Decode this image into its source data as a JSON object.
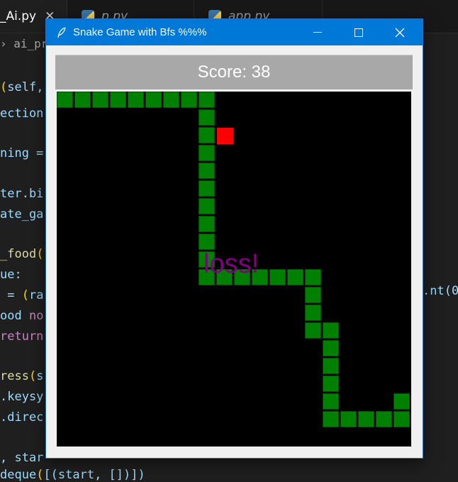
{
  "editor": {
    "tabs": [
      {
        "label": "_Ai.py",
        "close": "✕"
      },
      {
        "label": "p.py"
      },
      {
        "label": "app.py"
      }
    ],
    "breadcrumb": "› ai_pro",
    "lines": [
      {
        "parts": [
          [
            "par",
            "("
          ],
          [
            "sf",
            "self,"
          ]
        ]
      },
      {
        "parts": [
          [
            "sf",
            "ection"
          ]
        ]
      },
      {
        "parts": [
          [
            "sf",
            "ning ="
          ]
        ]
      },
      {
        "parts": [
          [
            "sf",
            "ter.bi"
          ]
        ]
      },
      {
        "parts": [
          [
            "sf",
            "ate_ga"
          ]
        ]
      },
      {
        "parts": [
          [
            "fn",
            "_food"
          ],
          [
            "par",
            "("
          ]
        ]
      },
      {
        "parts": [
          [
            "sf",
            "ue:"
          ]
        ]
      },
      {
        "parts": [
          [
            "sf",
            " = "
          ],
          [
            "par",
            "("
          ],
          [
            "sf",
            "ra"
          ]
        ]
      },
      {
        "parts": [
          [
            "sf",
            "ood "
          ],
          [
            "kw",
            "no"
          ]
        ]
      },
      {
        "parts": [
          [
            "kw",
            "return"
          ]
        ]
      },
      {
        "parts": [
          [
            "fn",
            "ress"
          ],
          [
            "par",
            "("
          ],
          [
            "sf",
            "s"
          ]
        ]
      },
      {
        "parts": [
          [
            "sf",
            ".keysy"
          ]
        ]
      },
      {
        "parts": [
          [
            "sf",
            ".direc"
          ]
        ]
      },
      {
        "parts": [
          [
            "sf",
            ", star"
          ]
        ]
      },
      {
        "parts": [
          [
            "sf",
            "deque"
          ],
          [
            "par",
            "("
          ],
          [
            "sf",
            "[(start, [])])"
          ]
        ]
      }
    ],
    "right_fragment": ".nt(0"
  },
  "window": {
    "title": "Snake Game with Bfs %%%",
    "score_label": "Score: 38",
    "status_text": "loss!",
    "colors": {
      "snake": "#008000",
      "food": "#ff0000",
      "board": "#000000",
      "status": "#800080"
    },
    "grid": {
      "cols": 20,
      "rows": 20
    },
    "snake_cells": [
      [
        0,
        0
      ],
      [
        1,
        0
      ],
      [
        2,
        0
      ],
      [
        3,
        0
      ],
      [
        4,
        0
      ],
      [
        5,
        0
      ],
      [
        6,
        0
      ],
      [
        7,
        0
      ],
      [
        8,
        0
      ],
      [
        8,
        1
      ],
      [
        8,
        2
      ],
      [
        8,
        3
      ],
      [
        8,
        4
      ],
      [
        8,
        5
      ],
      [
        8,
        6
      ],
      [
        8,
        7
      ],
      [
        8,
        8
      ],
      [
        8,
        9
      ],
      [
        8,
        10
      ],
      [
        9,
        10
      ],
      [
        10,
        10
      ],
      [
        11,
        10
      ],
      [
        12,
        10
      ],
      [
        13,
        10
      ],
      [
        14,
        10
      ],
      [
        14,
        11
      ],
      [
        14,
        12
      ],
      [
        14,
        13
      ],
      [
        15,
        13
      ],
      [
        15,
        14
      ],
      [
        15,
        15
      ],
      [
        15,
        16
      ],
      [
        15,
        17
      ],
      [
        15,
        18
      ],
      [
        16,
        18
      ],
      [
        17,
        18
      ],
      [
        18,
        18
      ],
      [
        19,
        18
      ],
      [
        19,
        17
      ]
    ],
    "food_cell": [
      9,
      2
    ]
  }
}
